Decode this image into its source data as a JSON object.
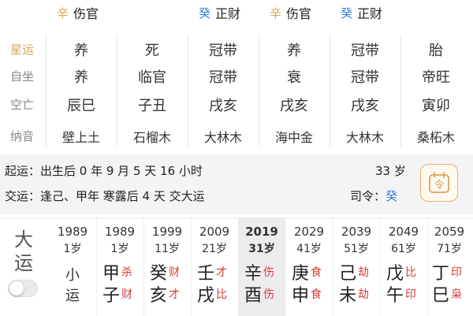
{
  "top_gods": [
    {
      "stem": "辛",
      "stem_color": "#d9a45a",
      "god": "伤官"
    },
    {
      "stem": "癸",
      "stem_color": "#2f7fe0",
      "god": "正财"
    },
    {
      "stem": "辛",
      "stem_color": "#d9a45a",
      "god": "伤官"
    },
    {
      "stem": "癸",
      "stem_color": "#2f7fe0",
      "god": "正财"
    }
  ],
  "row_labels": [
    "星运",
    "自坐",
    "空亡",
    "纳音"
  ],
  "pillars": [
    {
      "xingyun": "养",
      "zizuo": "养",
      "kongwang": "辰巳",
      "nayin": "壁上土"
    },
    {
      "xingyun": "死",
      "zizuo": "临官",
      "kongwang": "子丑",
      "nayin": "石榴木"
    },
    {
      "xingyun": "冠带",
      "zizuo": "冠带",
      "kongwang": "戌亥",
      "nayin": "大林木"
    },
    {
      "xingyun": "养",
      "zizuo": "衰",
      "kongwang": "戌亥",
      "nayin": "海中金"
    },
    {
      "xingyun": "冠带",
      "zizuo": "冠带",
      "kongwang": "戌亥",
      "nayin": "大林木"
    },
    {
      "xingyun": "胎",
      "zizuo": "帝旺",
      "kongwang": "寅卯",
      "nayin": "桑柘木"
    }
  ],
  "info": {
    "qiyun_label": "起运：",
    "qiyun_text": "出生后 0 年 9 月 5 天 16 小时",
    "qiyun_age": "33 岁",
    "jiaoyun_label": "交运：",
    "jiaoyun_text": "逢己、甲年 寒露后 4 天 交大运",
    "siling_label": "司令：",
    "siling_value": "癸",
    "siling_icon": "ling-calendar-icon",
    "button_glyph": "令"
  },
  "dayun": {
    "label_top": "大",
    "label_bottom": "运",
    "toggle_on": false,
    "columns": [
      {
        "year": "1989",
        "age": "1岁",
        "xiao": [
          "小",
          "运"
        ],
        "gan": "",
        "zhi": "",
        "gan_god": "",
        "zhi_god": ""
      },
      {
        "year": "1989",
        "age": "1岁",
        "gan": "甲",
        "zhi": "子",
        "gan_god": "杀",
        "zhi_god": "财"
      },
      {
        "year": "1999",
        "age": "11岁",
        "gan": "癸",
        "zhi": "亥",
        "gan_god": "财",
        "zhi_god": "才"
      },
      {
        "year": "2009",
        "age": "21岁",
        "gan": "壬",
        "zhi": "戌",
        "gan_god": "才",
        "zhi_god": "比"
      },
      {
        "year": "2019",
        "age": "31岁",
        "gan": "辛",
        "zhi": "酉",
        "gan_god": "伤",
        "zhi_god": "伤",
        "active": true
      },
      {
        "year": "2029",
        "age": "41岁",
        "gan": "庚",
        "zhi": "申",
        "gan_god": "食",
        "zhi_god": "食"
      },
      {
        "year": "2039",
        "age": "51岁",
        "gan": "己",
        "zhi": "未",
        "gan_god": "劫",
        "zhi_god": "劫"
      },
      {
        "year": "2049",
        "age": "61岁",
        "gan": "戊",
        "zhi": "午",
        "gan_god": "比",
        "zhi_god": "印"
      },
      {
        "year": "2059",
        "age": "71岁",
        "gan": "丁",
        "zhi": "巳",
        "gan_god": "印",
        "zhi_god": "枭"
      }
    ]
  },
  "colors": {
    "accent_gold": "#d9a45a",
    "accent_blue": "#2f7fe0",
    "god_red": "#d83a3a"
  }
}
